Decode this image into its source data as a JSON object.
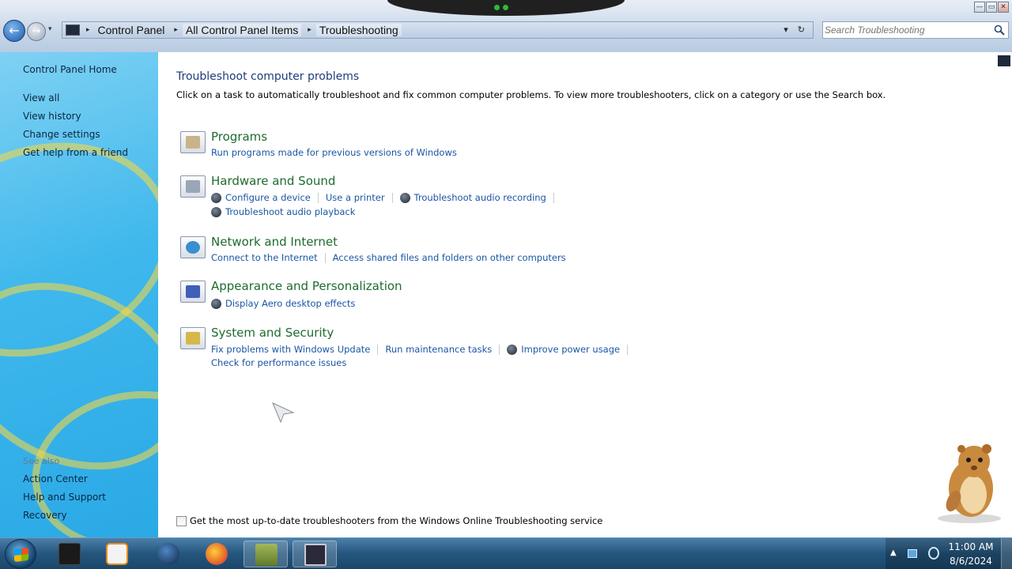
{
  "window": {
    "minimize_label": "—",
    "maximize_label": "▭",
    "close_label": "✕"
  },
  "address_bar": {
    "breadcrumbs": [
      "Control Panel",
      "All Control Panel Items",
      "Troubleshooting"
    ],
    "separator": "▸",
    "dropdown_glyph": "▾",
    "refresh_glyph": "↻"
  },
  "search": {
    "placeholder": "Search Troubleshooting"
  },
  "sidebar": {
    "home": "Control Panel Home",
    "items": [
      "View all",
      "View history",
      "Change settings",
      "Get help from a friend"
    ],
    "see_also_label": "See also",
    "see_also": [
      "Action Center",
      "Help and Support",
      "Recovery"
    ]
  },
  "main": {
    "title": "Troubleshoot computer problems",
    "description": "Click on a task to automatically troubleshoot and fix common computer problems. To view more troubleshooters, click on a category or use the Search box.",
    "categories": [
      {
        "title": "Programs",
        "icon": "programs-icon",
        "icon_color": "#c9b38a",
        "rows": [
          [
            {
              "label": "Run programs made for previous versions of Windows",
              "shield": false
            }
          ]
        ]
      },
      {
        "title": "Hardware and Sound",
        "icon": "hardware-sound-icon",
        "icon_color": "#9aa5b5",
        "rows": [
          [
            {
              "label": "Configure a device",
              "shield": true
            },
            {
              "label": "Use a printer",
              "shield": false
            },
            {
              "label": "Troubleshoot audio recording",
              "shield": true
            }
          ],
          [
            {
              "label": "Troubleshoot audio playback",
              "shield": true
            }
          ]
        ]
      },
      {
        "title": "Network and Internet",
        "icon": "network-internet-icon",
        "icon_color": "#3a8fd0",
        "rows": [
          [
            {
              "label": "Connect to the Internet",
              "shield": false
            },
            {
              "label": "Access shared files and folders on other computers",
              "shield": false
            }
          ]
        ]
      },
      {
        "title": "Appearance and Personalization",
        "icon": "appearance-personalization-icon",
        "icon_color": "#3f5fb8",
        "rows": [
          [
            {
              "label": "Display Aero desktop effects",
              "shield": true
            }
          ]
        ]
      },
      {
        "title": "System and Security",
        "icon": "system-security-icon",
        "icon_color": "#d6b74a",
        "rows": [
          [
            {
              "label": "Fix problems with Windows Update",
              "shield": false
            },
            {
              "label": "Run maintenance tasks",
              "shield": false
            },
            {
              "label": "Improve power usage",
              "shield": true
            }
          ],
          [
            {
              "label": "Check for performance issues",
              "shield": false
            }
          ]
        ]
      }
    ],
    "online_checkbox_label": "Get the most up-to-date troubleshooters from the Windows Online Troubleshooting service",
    "online_checkbox_checked": false
  },
  "colors": {
    "category_title": "#1e6b2f",
    "link": "#1a56a3",
    "page_title": "#1d3d7b",
    "sidebar_link": "#0c2540"
  },
  "taskbar": {
    "start_icon": "windows-start-icon",
    "items": [
      {
        "name": "taskbar-item-terminal",
        "icon": "terminal-icon",
        "color": "#1a1a1a"
      },
      {
        "name": "taskbar-item-media",
        "icon": "media-player-icon",
        "color": "#f08a1c"
      },
      {
        "name": "taskbar-item-globe",
        "icon": "globe-icon",
        "color": "#1d5d9a"
      },
      {
        "name": "taskbar-item-firefox",
        "icon": "firefox-icon",
        "color": "#e8692a"
      },
      {
        "name": "taskbar-item-box",
        "icon": "box-app-icon",
        "color": "#6f8a3c",
        "active": true
      },
      {
        "name": "taskbar-item-window",
        "icon": "window-app-icon",
        "color": "#2a2a3a",
        "active": true
      }
    ],
    "tray_arrow": "▲",
    "clock_time": "11:00 AM",
    "clock_date": "8/6/2024"
  }
}
